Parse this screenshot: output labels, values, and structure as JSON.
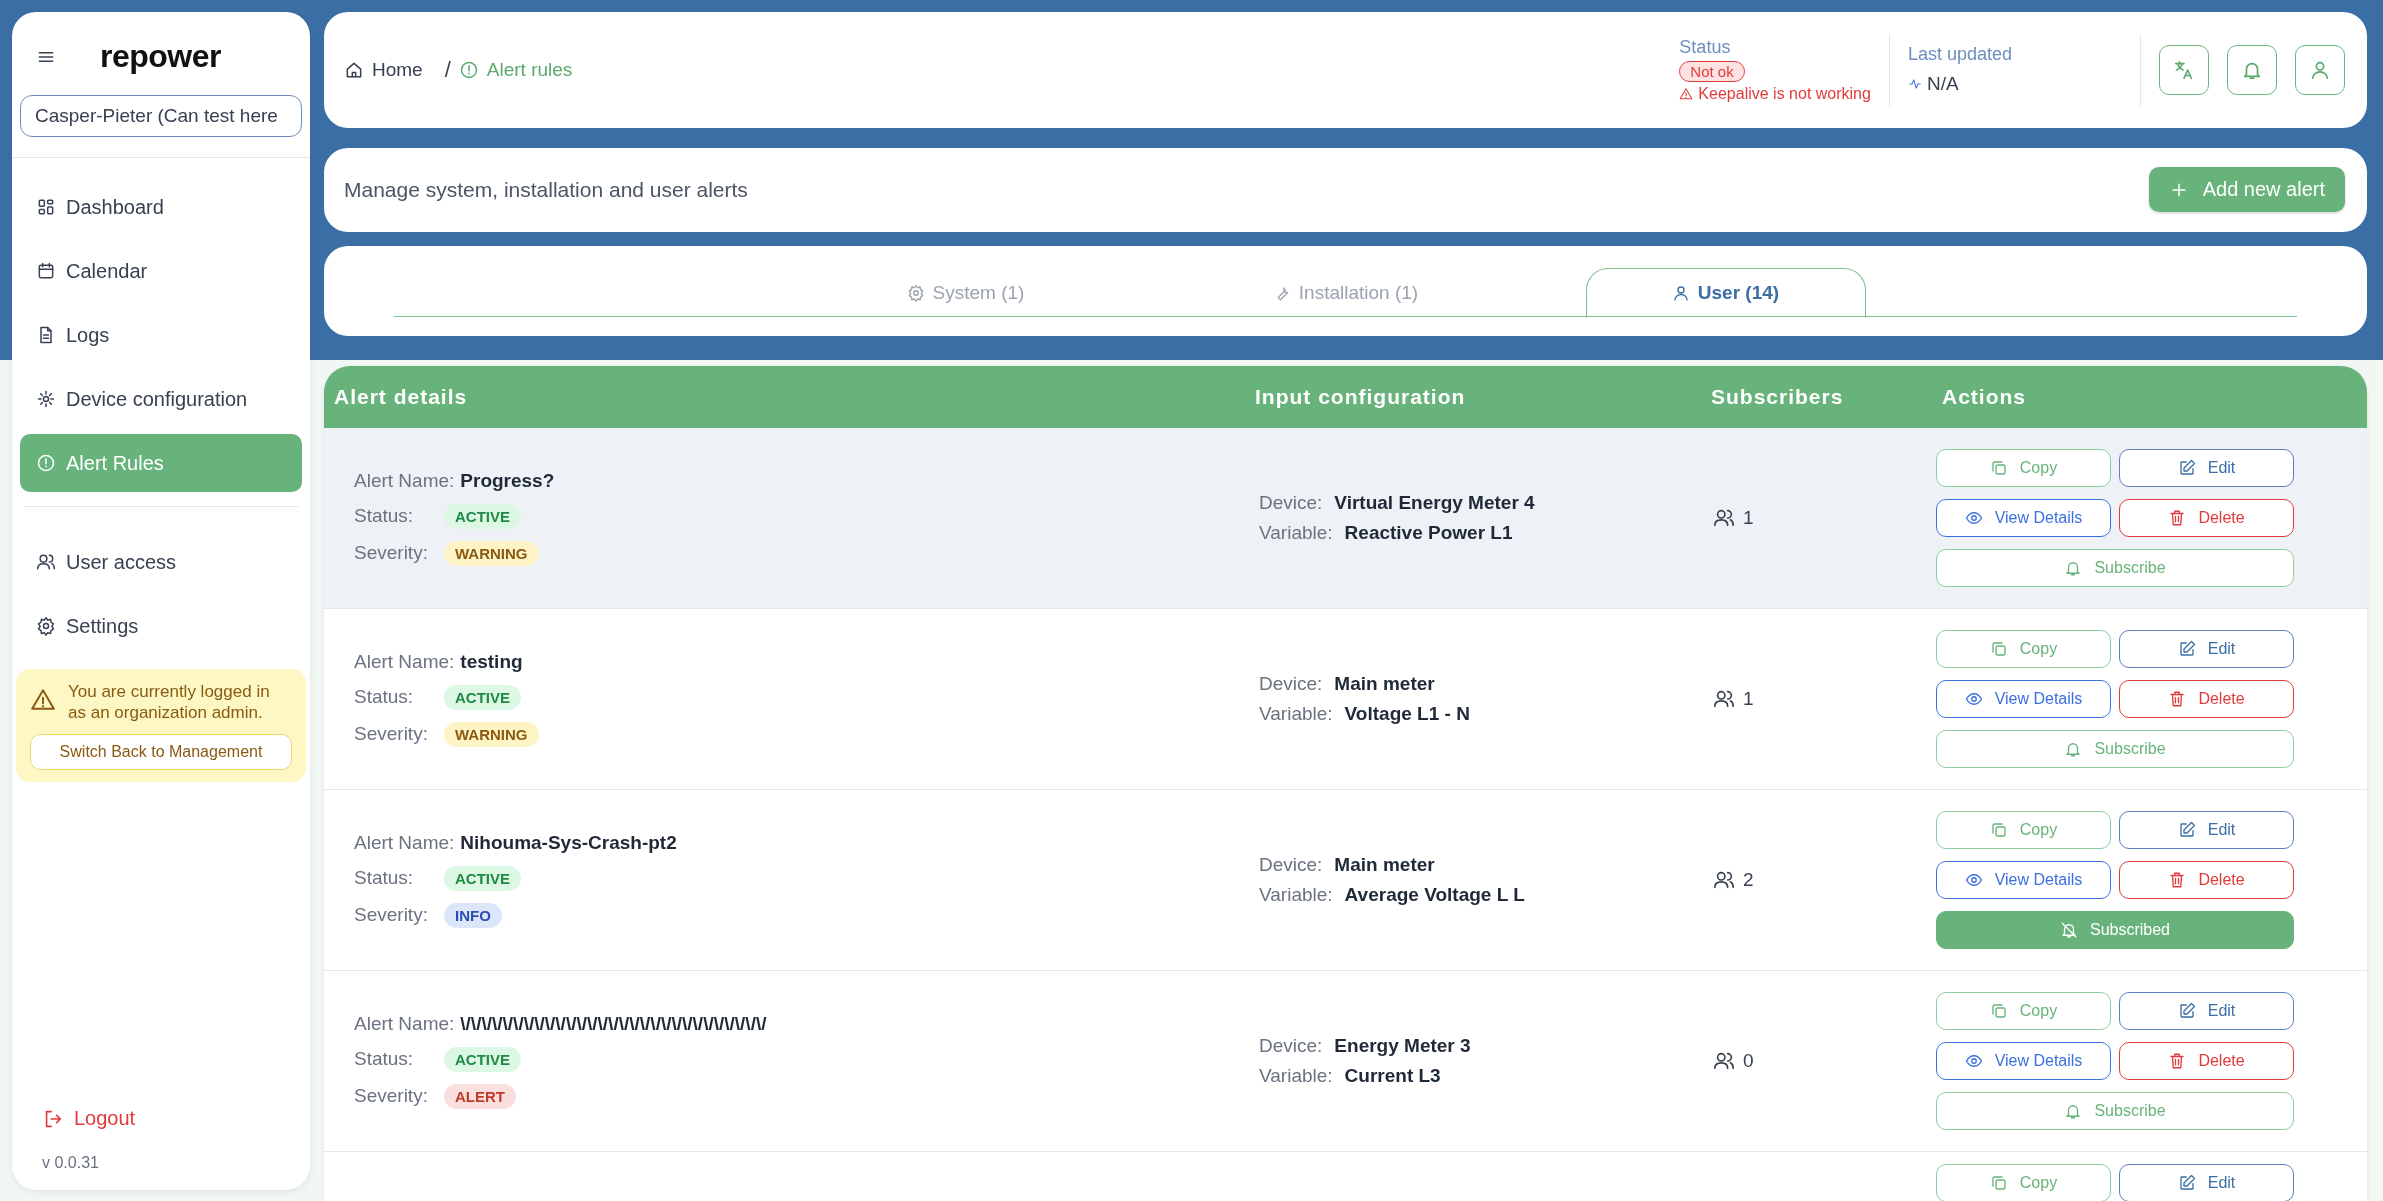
{
  "sidebar": {
    "logo": "repower",
    "organization": {
      "value": "Casper-Pieter (Can test here"
    },
    "nav_groups": [
      {
        "items": [
          {
            "label": "Dashboard",
            "selected": false
          },
          {
            "label": "Calendar",
            "selected": false
          },
          {
            "label": "Logs",
            "selected": false
          },
          {
            "label": "Device configuration",
            "selected": false
          },
          {
            "label": "Alert Rules",
            "selected": true
          }
        ]
      },
      {
        "items": [
          {
            "label": "User access",
            "selected": false
          },
          {
            "label": "Settings",
            "selected": false
          }
        ]
      }
    ],
    "notice": {
      "message": "You are currently logged in as an organization admin.",
      "button": "Switch Back to Management"
    },
    "logout": "Logout",
    "version": "v 0.0.31"
  },
  "header": {
    "breadcrumb_separator": "/",
    "breadcrumb": [
      {
        "label": "Home",
        "selected": false
      },
      {
        "label": "Alert rules",
        "selected": true
      }
    ],
    "status": {
      "label": "Status",
      "badge": "Not ok",
      "message": "Keepalive is not working"
    },
    "last_updated": {
      "label": "Last updated",
      "value": "N/A"
    }
  },
  "intro": {
    "text": "Manage system, installation and user alerts",
    "button": "Add new alert"
  },
  "tabs": [
    {
      "label": "System (1)",
      "selected": false
    },
    {
      "label": "Installation (1)",
      "selected": false
    },
    {
      "label": "User (14)",
      "selected": true
    }
  ],
  "table": {
    "columns": [
      "Alert details",
      "Input configuration",
      "Subscribers",
      "Actions"
    ],
    "rows": [
      {
        "highlighted": true,
        "name_label": "Alert Name:",
        "name": "Progress?",
        "status_label": "Status:",
        "status": "ACTIVE",
        "severity_label": "Severity:",
        "severity": {
          "label": "WARNING",
          "kind": "warning"
        },
        "device_label": "Device:",
        "device": "Virtual Energy Meter 4",
        "variable_label": "Variable:",
        "variable": "Reactive Power L1",
        "subscribers": "1",
        "copy": "Copy",
        "edit": "Edit",
        "view": "View Details",
        "delete": "Delete",
        "subscribe": {
          "label": "Subscribe",
          "subscribed": false
        }
      },
      {
        "highlighted": false,
        "name_label": "Alert Name:",
        "name": "testing",
        "status_label": "Status:",
        "status": "ACTIVE",
        "severity_label": "Severity:",
        "severity": {
          "label": "WARNING",
          "kind": "warning"
        },
        "device_label": "Device:",
        "device": "Main meter",
        "variable_label": "Variable:",
        "variable": "Voltage L1 - N",
        "subscribers": "1",
        "copy": "Copy",
        "edit": "Edit",
        "view": "View Details",
        "delete": "Delete",
        "subscribe": {
          "label": "Subscribe",
          "subscribed": false
        }
      },
      {
        "highlighted": false,
        "name_label": "Alert Name:",
        "name": "Nihouma-Sys-Crash-pt2",
        "status_label": "Status:",
        "status": "ACTIVE",
        "severity_label": "Severity:",
        "severity": {
          "label": "INFO",
          "kind": "info"
        },
        "device_label": "Device:",
        "device": "Main meter",
        "variable_label": "Variable:",
        "variable": "Average Voltage L L",
        "subscribers": "2",
        "copy": "Copy",
        "edit": "Edit",
        "view": "View Details",
        "delete": "Delete",
        "subscribe": {
          "label": "Subscribed",
          "subscribed": true
        }
      },
      {
        "highlighted": false,
        "name_label": "Alert Name:",
        "name": "\\/\\/\\/\\/\\/\\/\\/\\/\\/\\/\\/\\/\\/\\/\\/\\/\\/\\/\\/\\/\\/\\/\\/\\/\\/\\/\\/\\/\\/",
        "status_label": "Status:",
        "status": "ACTIVE",
        "severity_label": "Severity:",
        "severity": {
          "label": "ALERT",
          "kind": "alert"
        },
        "device_label": "Device:",
        "device": "Energy Meter 3",
        "variable_label": "Variable:",
        "variable": "Current L3",
        "subscribers": "0",
        "copy": "Copy",
        "edit": "Edit",
        "view": "View Details",
        "delete": "Delete",
        "subscribe": {
          "label": "Subscribe",
          "subscribed": false
        }
      }
    ],
    "partial_row": {
      "copy": "Copy",
      "edit": "Edit"
    }
  }
}
